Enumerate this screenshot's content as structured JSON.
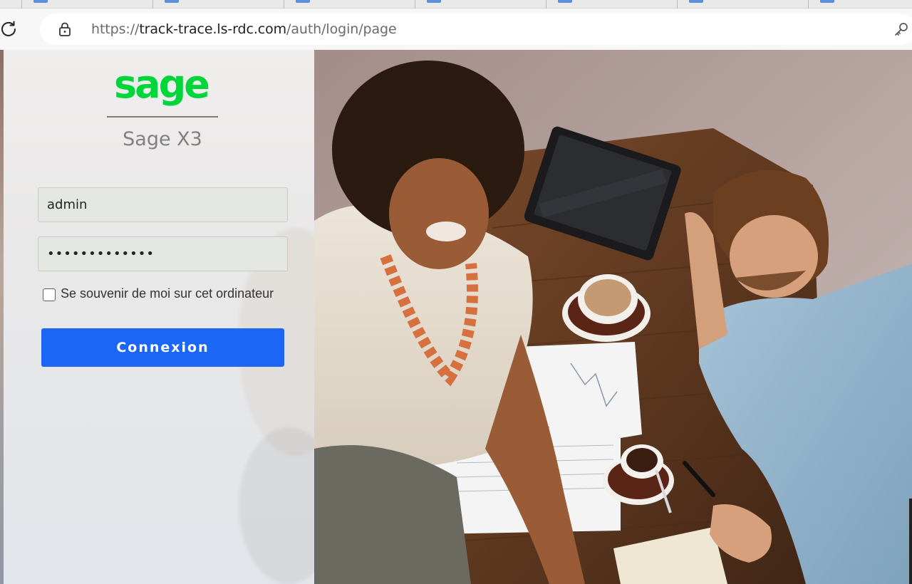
{
  "browser": {
    "url_scheme": "https://",
    "url_host": "track-trace.ls-rdc.com",
    "url_path": "/auth/login/page"
  },
  "login": {
    "logo_text": "sage",
    "product_name": "Sage X3",
    "username_value": "admin",
    "password_value": "•••••••••••••",
    "remember_label": "Se souvenir de moi sur cet ordinateur",
    "remember_checked": false,
    "submit_label": "Connexion"
  },
  "colors": {
    "brand_green": "#00d639",
    "button_blue": "#1c66f5",
    "field_bg": "#e4e6e1"
  },
  "icons": {
    "reload": "reload-icon",
    "lock": "lock-icon",
    "key": "key-icon"
  }
}
